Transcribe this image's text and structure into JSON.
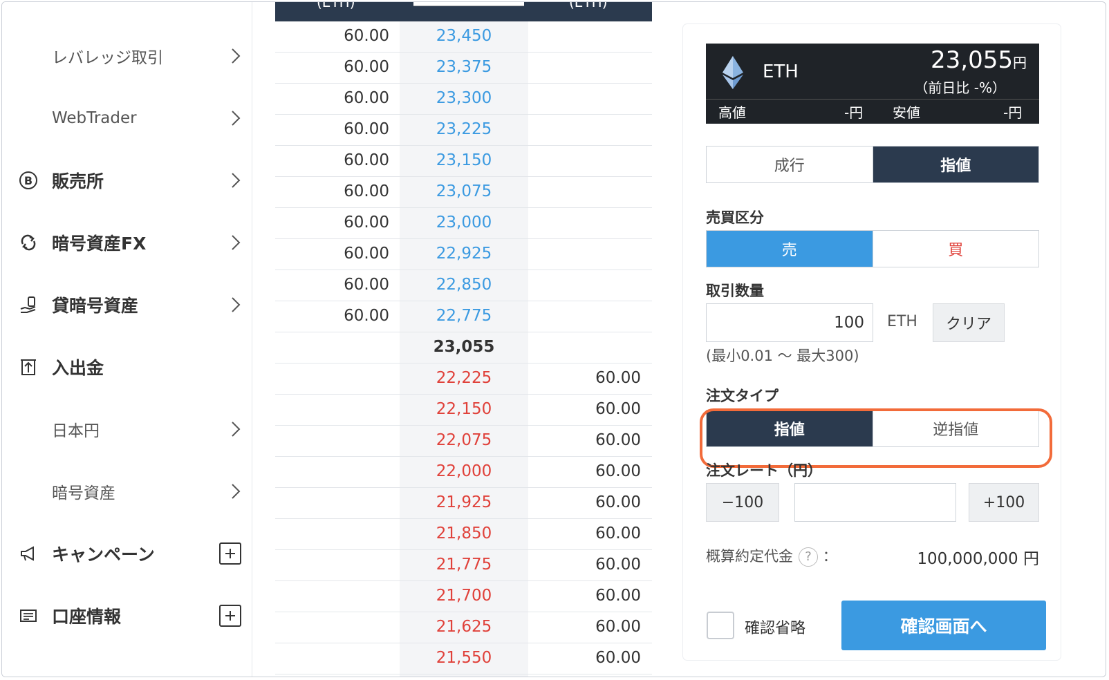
{
  "sidebar": {
    "items": [
      {
        "label": "レバレッジ取引",
        "icon": "",
        "type": "sub",
        "action": "chevron"
      },
      {
        "label": "WebTrader",
        "icon": "",
        "type": "sub",
        "action": "chevron"
      },
      {
        "label": "販売所",
        "icon": "bitcoin-icon",
        "type": "main",
        "action": "chevron"
      },
      {
        "label": "暗号資産FX",
        "icon": "exchange-arrows-icon",
        "type": "main",
        "action": "chevron"
      },
      {
        "label": "貸暗号資産",
        "icon": "lending-hand-icon",
        "type": "main",
        "action": "chevron"
      },
      {
        "label": "入出金",
        "icon": "deposit-withdraw-icon",
        "type": "main",
        "action": "none"
      },
      {
        "label": "日本円",
        "icon": "",
        "type": "sub",
        "action": "chevron"
      },
      {
        "label": "暗号資産",
        "icon": "",
        "type": "sub",
        "action": "chevron"
      },
      {
        "label": "キャンペーン",
        "icon": "megaphone-icon",
        "type": "main",
        "action": "plus"
      },
      {
        "label": "口座情報",
        "icon": "account-card-icon",
        "type": "main",
        "action": "plus"
      }
    ]
  },
  "orderbook": {
    "header_left": "(ETH)",
    "header_right": "(ETH)",
    "bids": [
      {
        "qty": "60.00",
        "price": "23,450"
      },
      {
        "qty": "60.00",
        "price": "23,375"
      },
      {
        "qty": "60.00",
        "price": "23,300"
      },
      {
        "qty": "60.00",
        "price": "23,225"
      },
      {
        "qty": "60.00",
        "price": "23,150"
      },
      {
        "qty": "60.00",
        "price": "23,075"
      },
      {
        "qty": "60.00",
        "price": "23,000"
      },
      {
        "qty": "60.00",
        "price": "22,925"
      },
      {
        "qty": "60.00",
        "price": "22,850"
      },
      {
        "qty": "60.00",
        "price": "22,775"
      }
    ],
    "mid_price": "23,055",
    "asks": [
      {
        "price": "22,225",
        "qty": "60.00"
      },
      {
        "price": "22,150",
        "qty": "60.00"
      },
      {
        "price": "22,075",
        "qty": "60.00"
      },
      {
        "price": "22,000",
        "qty": "60.00"
      },
      {
        "price": "21,925",
        "qty": "60.00"
      },
      {
        "price": "21,850",
        "qty": "60.00"
      },
      {
        "price": "21,775",
        "qty": "60.00"
      },
      {
        "price": "21,700",
        "qty": "60.00"
      },
      {
        "price": "21,625",
        "qty": "60.00"
      },
      {
        "price": "21,550",
        "qty": "60.00"
      }
    ]
  },
  "ticker": {
    "symbol": "ETH",
    "price": "23,055",
    "price_unit": "円",
    "change": "（前日比 -%）",
    "high_label": "高値",
    "high_value": "-円",
    "low_label": "安値",
    "low_value": "-円"
  },
  "order": {
    "tabs": [
      "成行",
      "指値"
    ],
    "side_label": "売買区分",
    "side_options": [
      "売",
      "買"
    ],
    "qty_label": "取引数量",
    "qty_value": "100",
    "qty_unit": "ETH",
    "clear_label": "クリア",
    "qty_range": "(最小0.01 〜 最大300)",
    "type_label": "注文タイプ",
    "type_options": [
      "指値",
      "逆指値"
    ],
    "rate_label": "注文レート（円）",
    "minus_label": "−100",
    "plus_label": "+100",
    "rate_value": "",
    "estimate_label": "概算約定代金",
    "estimate_help": "?",
    "estimate_colon": "：",
    "estimate_value": "100,000,000 円",
    "skip_confirm_label": "確認省略",
    "submit_label": "確認画面へ"
  },
  "colors": {
    "dark_navy": "#2b3a4e",
    "ask_red": "#e0413a",
    "bid_blue": "#3b9ae1",
    "highlight_orange": "#f26b3a",
    "ticker_bg": "#1f2328"
  }
}
